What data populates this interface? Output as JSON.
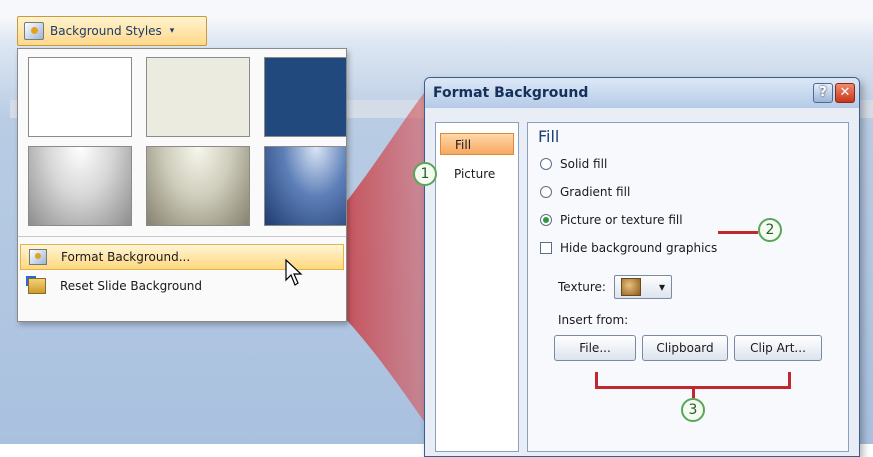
{
  "ribbon": {
    "background_styles_label": "Background Styles",
    "caret": "▾"
  },
  "gallery": {
    "swatches": [
      {
        "name": "white",
        "color": "#ffffff"
      },
      {
        "name": "cream",
        "color": "#ecebe0"
      },
      {
        "name": "navy",
        "color": "#22497e"
      },
      {
        "name": "gray-gradient",
        "color": "#b0b0b0"
      },
      {
        "name": "tan-gradient",
        "color": "#b6b49e"
      },
      {
        "name": "blue-gradient",
        "color": "#4a6ea8"
      }
    ],
    "menu": {
      "format_background": "Format Background...",
      "reset_slide_background": "Reset Slide Background"
    }
  },
  "dialog": {
    "title": "Format Background",
    "help_label": "?",
    "close_label": "✕",
    "nav": {
      "fill": "Fill",
      "picture": "Picture"
    },
    "fill_heading": "Fill",
    "options": {
      "solid_fill": "Solid fill",
      "gradient_fill": "Gradient fill",
      "picture_or_texture_fill": "Picture or texture fill",
      "hide_background_graphics": "Hide background graphics"
    },
    "selected_option": "picture_or_texture_fill",
    "texture_label": "Texture:",
    "insert_from_label": "Insert from:",
    "buttons": {
      "file": "File...",
      "clipboard": "Clipboard",
      "clip_art": "Clip Art..."
    }
  },
  "callouts": {
    "one": "1",
    "two": "2",
    "three": "3"
  },
  "colors": {
    "callout_red": "#c0282e",
    "callout_green": "#5aa55a",
    "accent_orange": "#f6a860"
  }
}
